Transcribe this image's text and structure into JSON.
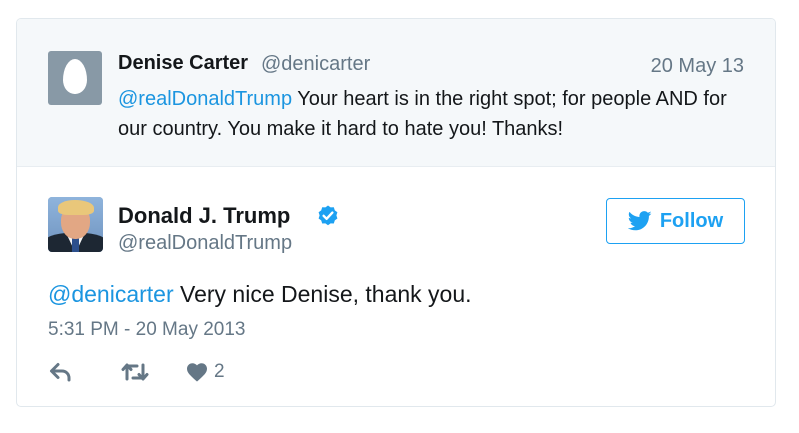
{
  "quoted_tweet": {
    "author_name": "Denise Carter",
    "author_handle": "@denicarter",
    "date": "20 May 13",
    "mention": "@realDonaldTrump",
    "text": " Your heart is in the right spot; for people AND for our country. You make it hard to hate you! Thanks!"
  },
  "tweet": {
    "author_name": "Donald J. Trump",
    "author_handle": "@realDonaldTrump",
    "verified": true,
    "follow_label": "Follow",
    "mention": "@denicarter",
    "text": " Very nice Denise, thank you.",
    "timestamp": "5:31 PM - 20 May 2013",
    "like_count": "2"
  },
  "icons": {
    "quoted_avatar": "default-egg-avatar",
    "verified": "verified-badge-icon",
    "follow": "twitter-bird-icon",
    "reply": "reply-icon",
    "retweet": "retweet-icon",
    "like": "heart-icon"
  },
  "colors": {
    "accent": "#1da1f2",
    "mention": "#1b95e0",
    "muted_text": "#657786",
    "quoted_background": "#f5f8fa",
    "border": "#e1e8ed",
    "icon_gray": "#657786"
  }
}
